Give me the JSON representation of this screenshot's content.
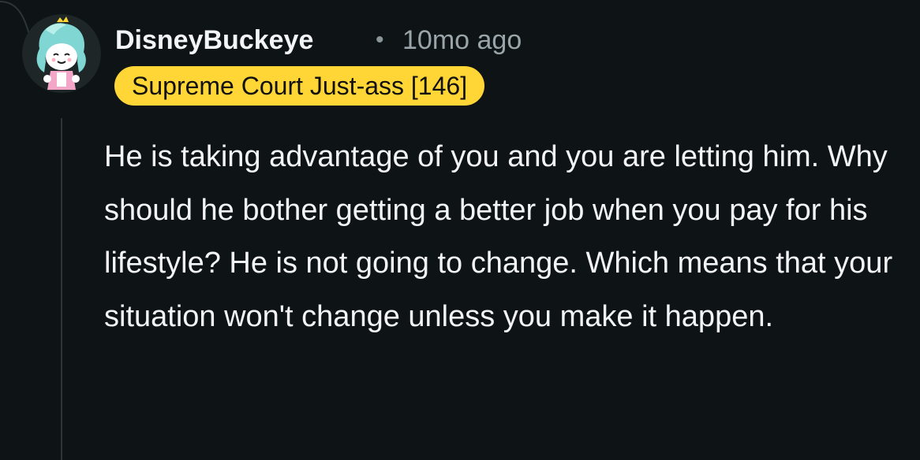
{
  "comment": {
    "author": "DisneyBuckeye",
    "separator": "•",
    "timestamp": "10mo ago",
    "flair": "Supreme Court Just-ass [146]",
    "body": "He is taking advantage of you and you are letting him. Why should he bother getting a better job when you pay for his lifestyle? He is not going to change. Which means that your situation won't change unless you make it happen."
  },
  "colors": {
    "background": "#0e1416",
    "flair_background": "#ffd635",
    "flair_text": "#111111",
    "text": "#f2f4f5",
    "muted_text": "#9aa5a9",
    "thread_line": "#2e3538"
  },
  "icons": {
    "avatar": "snoo-avatar-icon",
    "thread": "thread-connector-line"
  }
}
